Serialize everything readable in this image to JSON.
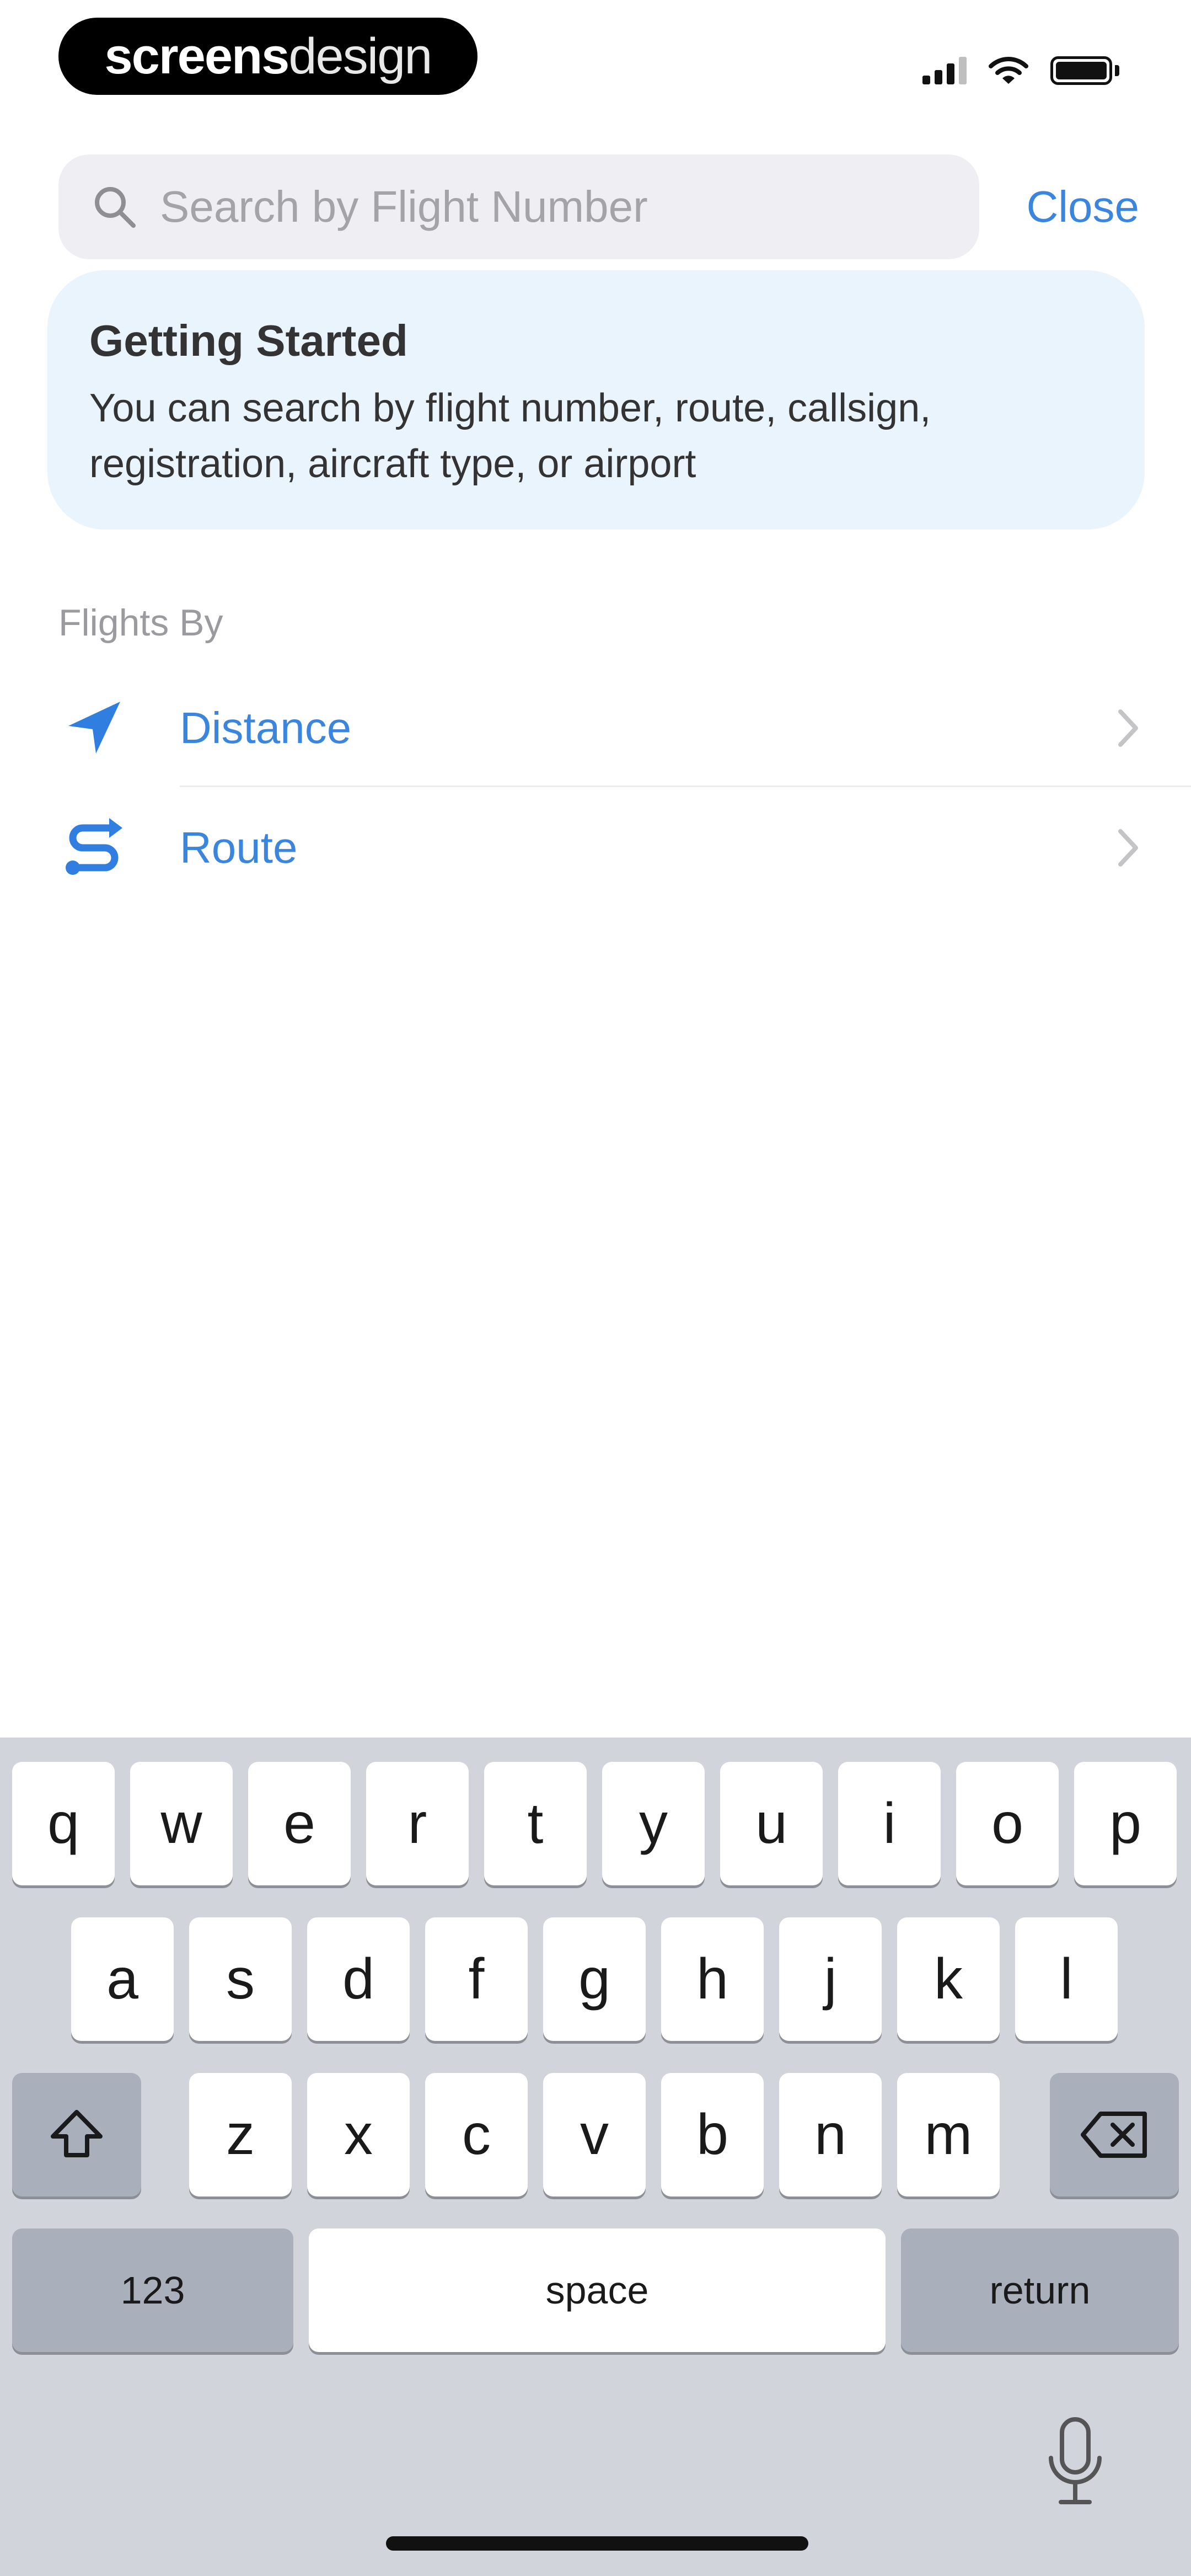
{
  "status_bar": {
    "brand_strong": "screens",
    "brand_light": "design",
    "icons": [
      "cellular-signal-icon",
      "wifi-icon",
      "battery-icon"
    ]
  },
  "search": {
    "placeholder": "Search by Flight Number",
    "value": "",
    "close_label": "Close"
  },
  "info_card": {
    "title": "Getting Started",
    "body": "You can search by flight number, route, callsign, registration, aircraft type, or airport"
  },
  "flights_by": {
    "header": "Flights By",
    "items": [
      {
        "label": "Distance",
        "icon": "location-arrow-icon"
      },
      {
        "label": "Route",
        "icon": "route-icon"
      }
    ]
  },
  "keyboard": {
    "row1": [
      "q",
      "w",
      "e",
      "r",
      "t",
      "y",
      "u",
      "i",
      "o",
      "p"
    ],
    "row2": [
      "a",
      "s",
      "d",
      "f",
      "g",
      "h",
      "j",
      "k",
      "l"
    ],
    "row3": [
      "z",
      "x",
      "c",
      "v",
      "b",
      "n",
      "m"
    ],
    "numbers_label": "123",
    "space_label": "space",
    "return_label": "return",
    "icons": [
      "shift-icon",
      "delete-icon",
      "microphone-icon"
    ]
  },
  "colors": {
    "accent": "#3a86de",
    "card_background": "#e9f4fd",
    "keyboard_background": "#d1d4da",
    "special_key": "#a9b0bc"
  }
}
